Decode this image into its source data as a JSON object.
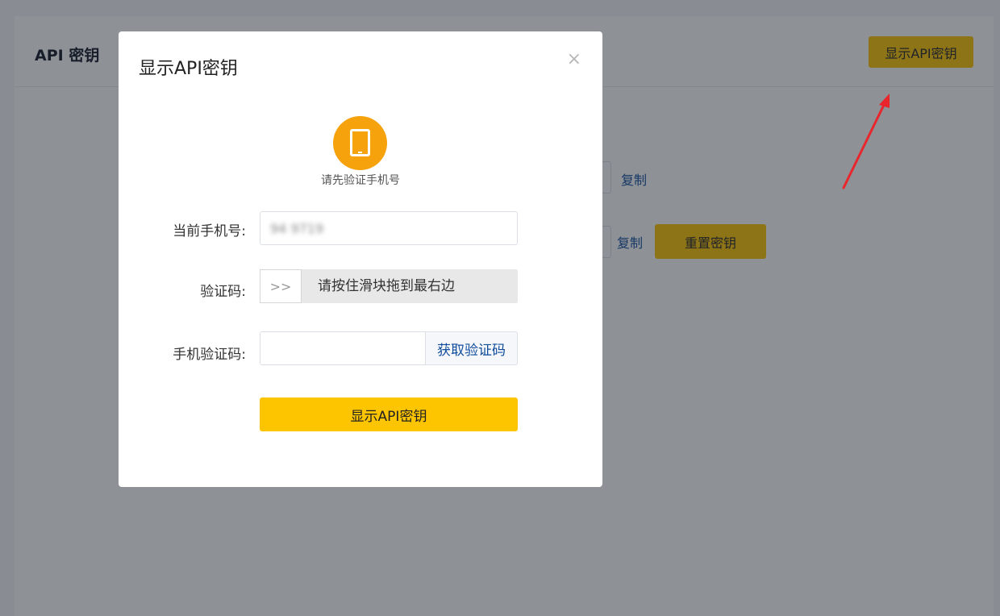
{
  "page": {
    "title": "API 密钥",
    "show_button": "显示API密钥",
    "copy_label_1": "复制",
    "copy_label_2": "复制",
    "reset_button": "重置密钥"
  },
  "modal": {
    "title": "显示API密钥",
    "close_glyph": "×",
    "phone_icon": "mobile-phone-icon",
    "verify_hint": "请先验证手机号",
    "phone_label": "当前手机号:",
    "phone_value": "94 9719",
    "captcha_label": "验证码:",
    "slider_glyph": ">>",
    "slider_text": "请按住滑块拖到最右边",
    "sms_label": "手机验证码:",
    "sms_value": "",
    "get_code_button": "获取验证码",
    "submit_button": "显示API密钥"
  },
  "colors": {
    "accent_yellow": "#fdc500",
    "icon_orange": "#f5a20d",
    "link_blue": "#0f4c9c",
    "arrow_red": "#e8262b"
  }
}
